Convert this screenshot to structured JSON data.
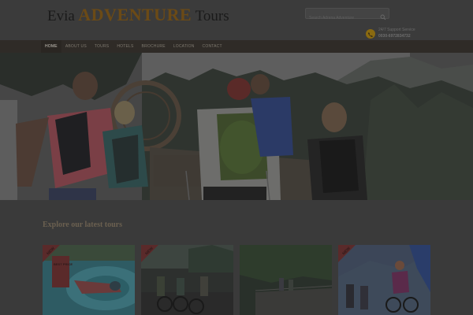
{
  "brand": {
    "word1": "Evia",
    "word2": "ADVENTURE",
    "word3": "Tours"
  },
  "search": {
    "placeholder": "Search Adrena Adventure"
  },
  "support": {
    "label": "24/7 Support Service",
    "phone": "0030-6972834732"
  },
  "nav": {
    "items": [
      {
        "label": "HOME",
        "active": true
      },
      {
        "label": "ABOUT US",
        "active": false
      },
      {
        "label": "TOURS",
        "active": false
      },
      {
        "label": "HOTELS",
        "active": false
      },
      {
        "label": "BROCHURE",
        "active": false
      },
      {
        "label": "LOCATION",
        "active": false
      },
      {
        "label": "CONTACT",
        "active": false
      }
    ]
  },
  "tours": {
    "title": "Explore our latest tours",
    "cards": [
      {
        "badge": "NEW",
        "extra": "BEST PRICE"
      },
      {
        "badge": "NEW"
      },
      {
        "badge": ""
      },
      {
        "badge": "NEW"
      }
    ]
  },
  "colors": {
    "accent": "#6b4a16",
    "nav_bg": "#2f2b27",
    "overlay": "#3a3a3a"
  }
}
